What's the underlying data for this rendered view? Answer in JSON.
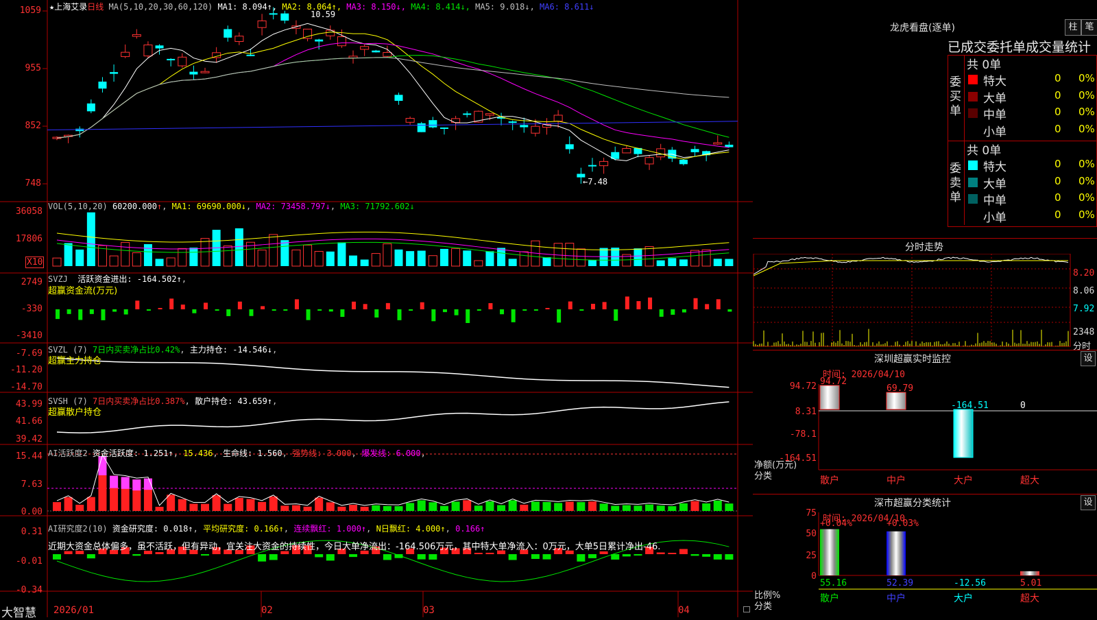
{
  "header": {
    "stock_name": "★上海艾录",
    "period": "日线",
    "ma_title": "MA(5,10,20,30,60,120)",
    "ma": [
      {
        "label": "MA1:",
        "value": "8.094",
        "arrow": "↑",
        "color": "#ffffff"
      },
      {
        "label": "MA2:",
        "value": "8.064",
        "arrow": "↑",
        "color": "#ffff00"
      },
      {
        "label": "MA3:",
        "value": "8.150",
        "arrow": "↓",
        "color": "#ff00ff"
      },
      {
        "label": "MA4:",
        "value": "8.414",
        "arrow": "↓",
        "color": "#00e600"
      },
      {
        "label": "MA5:",
        "value": "9.018",
        "arrow": "↓",
        "color": "#c0c0c0"
      },
      {
        "label": "MA6:",
        "value": "8.611",
        "arrow": "↓",
        "color": "#4040ff"
      }
    ],
    "peak_label": "10.59",
    "trough_label": "←7.48"
  },
  "price_axis": [
    "1059",
    "955",
    "852",
    "748"
  ],
  "vol": {
    "title": "VOL(5,10,20)",
    "value": "60200.000",
    "value_arrow": "↑",
    "ma1": "MA1: 69690.000↓",
    "ma2": "MA2: 73458.797↓",
    "ma3": "MA3: 71792.602↓",
    "axis": [
      "36058",
      "17806"
    ],
    "unit": "X10"
  },
  "svzj": {
    "title": "SVZJ",
    "label": "活跃资金进出: -164.502↑",
    "sub": "超赢资金流(万元)",
    "axis": [
      "2749",
      "-330",
      "-3410"
    ]
  },
  "svzl": {
    "title": "SVZL (7)",
    "label1": "7日内买卖净占比0.42%",
    "label2": "主力持仓: -14.546↓",
    "sub": "超赢主力持仓",
    "axis": [
      "-7.69",
      "-11.20",
      "-14.70"
    ]
  },
  "svsh": {
    "title": "SVSH (7)",
    "label1": "7日内买卖净占比0.387%",
    "label2": "散户持仓: 43.659↑",
    "sub": "超赢散户持仓",
    "axis": [
      "43.99",
      "41.66",
      "39.42"
    ]
  },
  "ai1": {
    "title": "AI活跃度2",
    "l1": "资金活跃度: 1.251↑",
    "l2": "15.436",
    "l3": "生命线: 1.560",
    "l4": "强势线: 3.000",
    "l5": "爆发线: 6.000",
    "axis": [
      "15.44",
      "7.63",
      "0.00"
    ]
  },
  "ai2": {
    "title": "AI研究度2(10)",
    "l1": "资金研究度: 0.018↑",
    "l2": "平均研究度: 0.166↑",
    "l3": "连续飘红: 1.000↑",
    "l4": "N日飘红: 4.000↑",
    "l5": "0.166↑",
    "comment": "近期大资金总体偏多，虽不活跃，但有异动，宜关注大资金的持续性，今日大单净流出：-164.506万元，其中特大单净流入：0万元，大单5日累计净出-46.",
    "axis": [
      "0.31",
      "-0.01",
      "-0.34"
    ]
  },
  "xaxis": {
    "brand": "大智慧",
    "labels": [
      "2026/01",
      "02",
      "03",
      "04"
    ]
  },
  "right": {
    "lh_title": "龙虎看盘(逐单)",
    "btn1": "柱",
    "btn2": "笔",
    "stats_title": "已成交委托单成交量统计",
    "buy_side": "委买单",
    "sell_side": "委卖单",
    "buy_total": "共 0单",
    "sell_total": "共 0单",
    "buy_rows": [
      {
        "name": "特大",
        "value": "0",
        "pct": "0%",
        "color": "#ff0000"
      },
      {
        "name": "大单",
        "value": "0",
        "pct": "0%",
        "color": "#8b0000"
      },
      {
        "name": "中单",
        "value": "0",
        "pct": "0%",
        "color": "#5a0000"
      },
      {
        "name": "小单",
        "value": "0",
        "pct": "0%",
        "color": "#000000"
      }
    ],
    "sell_rows": [
      {
        "name": "特大",
        "value": "0",
        "pct": "0%",
        "color": "#00ffff"
      },
      {
        "name": "大单",
        "value": "0",
        "pct": "0%",
        "color": "#008080"
      },
      {
        "name": "中单",
        "value": "0",
        "pct": "0%",
        "color": "#006060"
      },
      {
        "name": "小单",
        "value": "0",
        "pct": "0%",
        "color": "#000000"
      }
    ],
    "fs_title": "分时走势",
    "fs_axis": [
      "8.20",
      "8.06",
      "7.92"
    ],
    "fs_vol": "2348",
    "fs_unit": "分时",
    "sz_title": "深圳超赢实时监控",
    "sz_btn": "设",
    "sz_time": "时间: 2026/04/10",
    "sz_axis": [
      "94.72",
      "8.31",
      "-78.1",
      "-164.51"
    ],
    "sz_axis_unit1": "净额(万元)",
    "sz_axis_unit2": "分类",
    "sz_bars": [
      {
        "cat": "散户",
        "value": "94.72"
      },
      {
        "cat": "中户",
        "value": "69.79"
      },
      {
        "cat": "大户",
        "value": "-164.51"
      },
      {
        "cat": "超大",
        "value": "0"
      }
    ],
    "ss_title": "深市超赢分类统计",
    "ss_btn": "设",
    "ss_time": "时间: 2026/04/10",
    "ss_axis": [
      "75",
      "50",
      "25",
      "0"
    ],
    "ss_axis_unit1": "比例%",
    "ss_axis_unit2": "分类",
    "ss_tops": [
      "+0.04%",
      "+0.03%"
    ],
    "ss_bars": [
      {
        "cat": "散户",
        "value": "55.16"
      },
      {
        "cat": "中户",
        "value": "52.39"
      },
      {
        "cat": "大户",
        "value": "-12.56"
      },
      {
        "cat": "超大",
        "value": "5.01"
      }
    ]
  }
}
